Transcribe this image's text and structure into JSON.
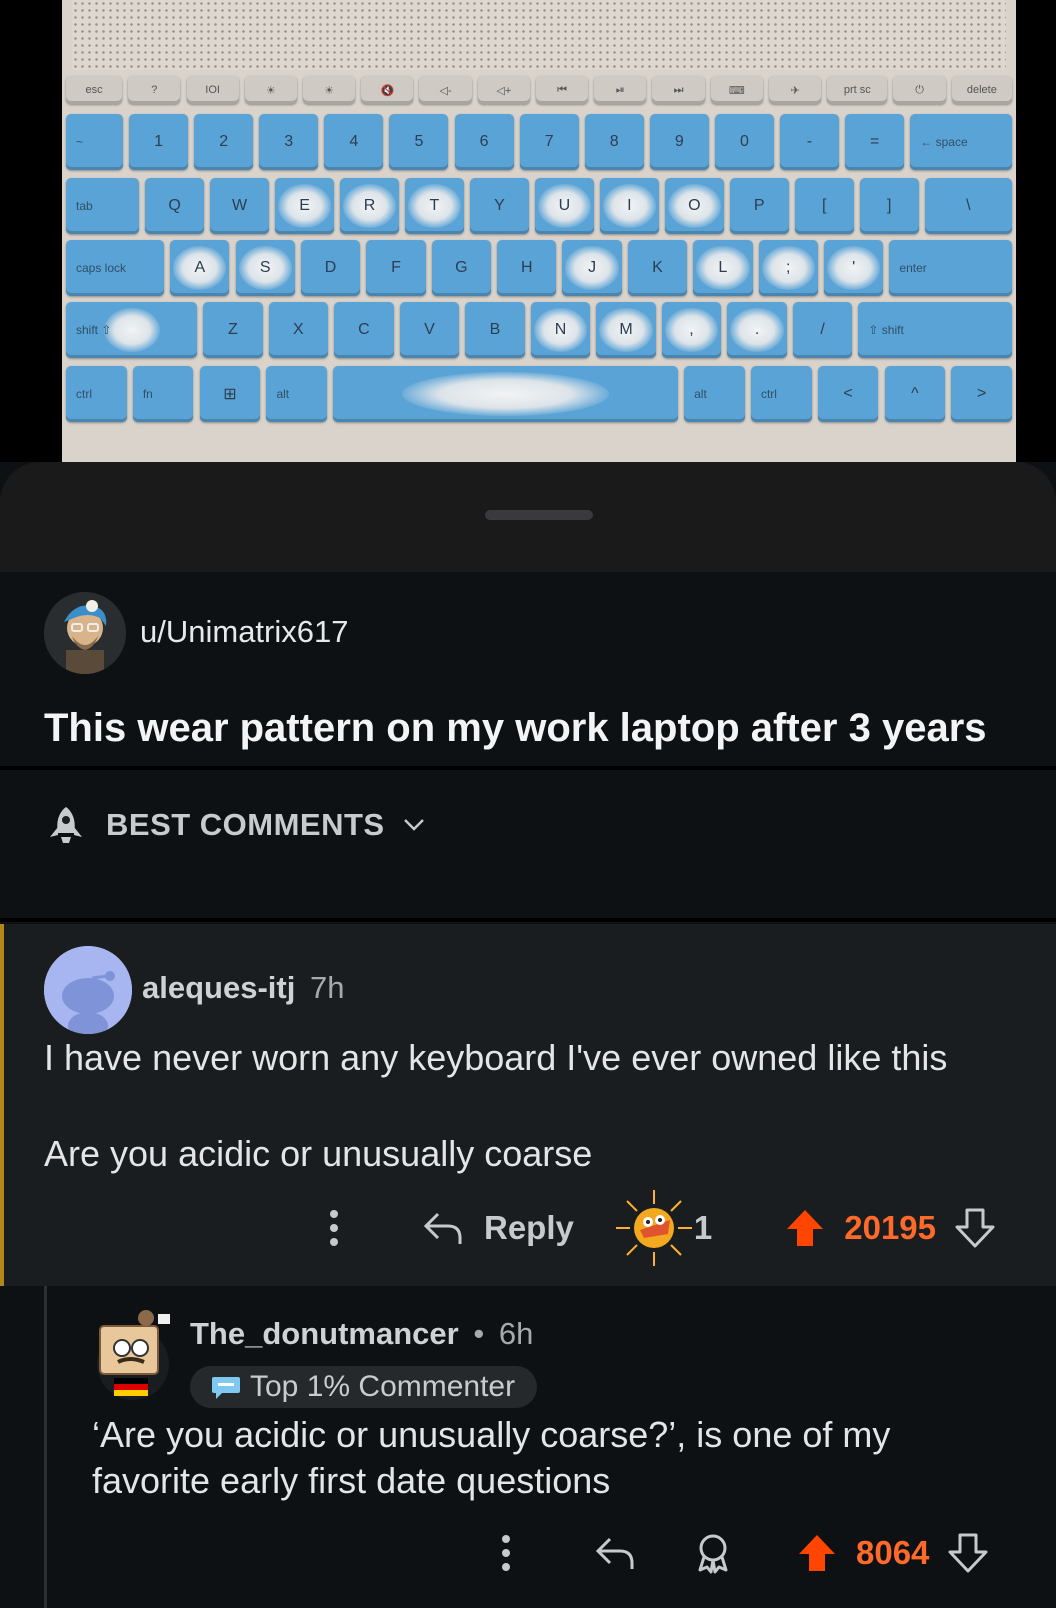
{
  "keyboard": {
    "function_row": [
      "esc",
      "?",
      "IOI",
      "☀",
      "☀",
      "🔇",
      "◁-",
      "◁+",
      "⏮",
      "⏯",
      "⏭",
      "⌨",
      "✈",
      "prt sc",
      "⏻",
      "delete"
    ],
    "number_row": [
      "~",
      "1",
      "2",
      "3",
      "4",
      "5",
      "6",
      "7",
      "8",
      "9",
      "0",
      "-",
      "=",
      "← space"
    ],
    "qwerty_row": [
      "tab",
      "Q",
      "W",
      "E",
      "R",
      "T",
      "Y",
      "U",
      "I",
      "O",
      "P",
      "[",
      "]",
      "\\"
    ],
    "home_row": [
      "caps lock",
      "A",
      "S",
      "D",
      "F",
      "G",
      "H",
      "J",
      "K",
      "L",
      ";",
      "'",
      "enter"
    ],
    "shift_row": [
      "shift ⇧",
      "Z",
      "X",
      "C",
      "V",
      "B",
      "N",
      "M",
      ",",
      ".",
      "/",
      "⇧ shift"
    ],
    "bottom_row": [
      "ctrl",
      "fn",
      "⊞",
      "alt",
      "",
      "alt",
      "ctrl",
      "<",
      "^",
      ">"
    ]
  },
  "post": {
    "author": "u/Unimatrix617",
    "title": "This wear pattern on my work laptop after 3 years"
  },
  "comments_header": {
    "label": "BEST COMMENTS"
  },
  "comment1": {
    "user": "aleques-itj",
    "time": "7h",
    "lines": [
      "I have never worn any keyboard I've ever owned like this",
      "Are you acidic or unusually coarse"
    ],
    "reply_label": "Reply",
    "award_count": "1",
    "score": "20195"
  },
  "comment2": {
    "user": "The_donutmancer",
    "separator": "•",
    "time": "6h",
    "flair": "Top 1% Commenter",
    "body": "‘Are you acidic or unusually coarse?’, is one of my favorite early first date questions",
    "score": "8064"
  },
  "colors": {
    "upvote": "#ff4500",
    "score_text": "#ff6a2b",
    "thread_accent": "#b38618",
    "key_blue": "#5aa3d6"
  }
}
